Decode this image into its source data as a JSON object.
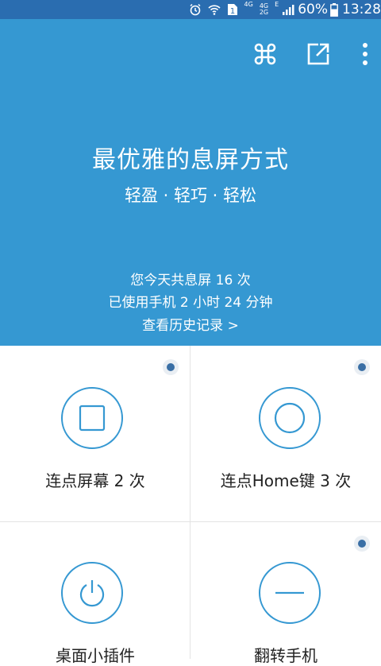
{
  "status_bar": {
    "net_4g": "4G",
    "net_small_top": "4G",
    "net_small_bottom": "2G",
    "net_e": "E",
    "battery": "60%",
    "time": "13:28"
  },
  "toolbar": {
    "icons": [
      "command-icon",
      "share-external-icon",
      "more-vertical-icon"
    ]
  },
  "header": {
    "title": "最优雅的息屏方式",
    "subtitle": "轻盈 · 轻巧 · 轻松",
    "stat_screen_off": "您今天共息屏 16 次",
    "stat_usage": "已使用手机 2 小时 24 分钟",
    "history_link": "查看历史记录 >"
  },
  "options": [
    {
      "label": "连点屏幕 2 次",
      "icon": "square-icon",
      "selected": true
    },
    {
      "label": "连点Home键 3 次",
      "icon": "ring-icon",
      "selected": true
    },
    {
      "label": "桌面小插件",
      "icon": "power-icon",
      "selected": false
    },
    {
      "label": "翻转手机",
      "icon": "dash-icon",
      "selected": true
    }
  ],
  "colors": {
    "header_bg": "#3598d2",
    "status_bg": "#2a6db0",
    "accent": "#3598d2",
    "radio_dot": "#3a6fa5"
  }
}
